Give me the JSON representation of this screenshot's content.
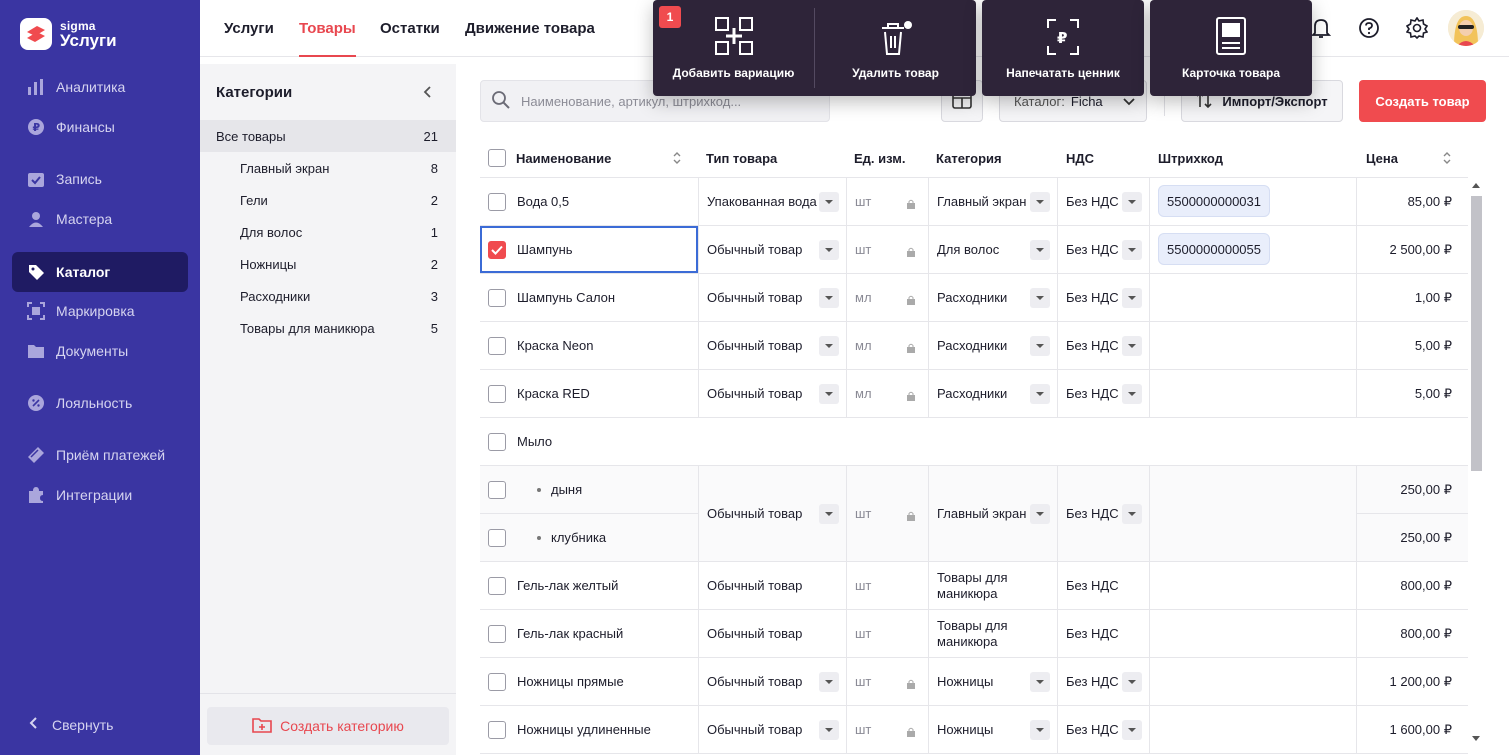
{
  "brand": {
    "sub": "sigma",
    "main": "Услуги"
  },
  "sidebar": {
    "items": [
      {
        "label": "Аналитика",
        "icon": "chart-icon"
      },
      {
        "label": "Финансы",
        "icon": "ruble-icon"
      },
      {
        "label": "Запись",
        "icon": "calendar-icon"
      },
      {
        "label": "Мастера",
        "icon": "user-icon"
      },
      {
        "label": "Каталог",
        "icon": "tag-icon",
        "active": true
      },
      {
        "label": "Маркировка",
        "icon": "qr-icon"
      },
      {
        "label": "Документы",
        "icon": "folder-icon"
      },
      {
        "label": "Лояльность",
        "icon": "discount-icon"
      },
      {
        "label": "Приём платежей",
        "icon": "card-icon"
      },
      {
        "label": "Интеграции",
        "icon": "puzzle-icon"
      }
    ],
    "collapse_label": "Свернуть"
  },
  "tabs": [
    {
      "label": "Услуги"
    },
    {
      "label": "Товары",
      "active": true
    },
    {
      "label": "Остатки"
    },
    {
      "label": "Движение товара"
    }
  ],
  "categories": {
    "title": "Категории",
    "items": [
      {
        "name": "Все товары",
        "count": "21",
        "selected": true
      },
      {
        "name": "Главный экран",
        "count": "8"
      },
      {
        "name": "Гели",
        "count": "2"
      },
      {
        "name": "Для волос",
        "count": "1"
      },
      {
        "name": "Ножницы",
        "count": "2"
      },
      {
        "name": "Расходники",
        "count": "3"
      },
      {
        "name": "Товары для маникюра",
        "count": "5"
      }
    ],
    "create_label": "Создать категорию"
  },
  "toolbar": {
    "search_placeholder": "Наименование, артикул, штрихкод...",
    "catalog_label": "Каталог:",
    "catalog_value": "Ficha",
    "import_label": "Импорт/Экспорт",
    "create_label": "Создать товар"
  },
  "table": {
    "headers": {
      "name": "Наименование",
      "type": "Тип товара",
      "unit": "Ед. изм.",
      "category": "Категория",
      "vat": "НДС",
      "barcode": "Штрихкод",
      "price": "Цена"
    },
    "rows": [
      {
        "name": "Вода 0,5",
        "type": "Упакованная вода",
        "unit": "шт",
        "category": "Главный экран",
        "vat": "Без НДС",
        "barcode": "5500000000031",
        "price": "85,00 ₽",
        "checked": false
      },
      {
        "name": "Шампунь",
        "type": "Обычный товар",
        "unit": "шт",
        "category": "Для волос",
        "vat": "Без НДС",
        "barcode": "5500000000055",
        "price": "2 500,00 ₽",
        "checked": true
      },
      {
        "name": "Шампунь Салон",
        "type": "Обычный товар",
        "unit": "мл",
        "category": "Расходники",
        "vat": "Без НДС",
        "barcode": "",
        "price": "1,00 ₽",
        "checked": false
      },
      {
        "name": "Краска Neon",
        "type": "Обычный товар",
        "unit": "мл",
        "category": "Расходники",
        "vat": "Без НДС",
        "barcode": "",
        "price": "5,00 ₽",
        "checked": false
      },
      {
        "name": "Краска RED",
        "type": "Обычный товар",
        "unit": "мл",
        "category": "Расходники",
        "vat": "Без НДС",
        "barcode": "",
        "price": "5,00 ₽",
        "checked": false
      }
    ],
    "group": {
      "name": "Мыло",
      "type": "Обычный товар",
      "unit": "шт",
      "category": "Главный экран",
      "vat": "Без НДС",
      "variants": [
        {
          "name": "дыня",
          "price": "250,00 ₽"
        },
        {
          "name": "клубника",
          "price": "250,00 ₽"
        }
      ]
    },
    "rows2": [
      {
        "name": "Гель-лак желтый",
        "type": "Обычный товар",
        "unit": "шт",
        "category": "Товары для маникюра",
        "vat": "Без НДС",
        "price": "800,00 ₽"
      },
      {
        "name": "Гель-лак красный",
        "type": "Обычный товар",
        "unit": "шт",
        "category": "Товары для маникюра",
        "vat": "Без НДС",
        "price": "800,00 ₽"
      },
      {
        "name": "Ножницы прямые",
        "type": "Обычный товар",
        "unit": "шт",
        "category": "Ножницы",
        "vat": "Без НДС",
        "price": "1 200,00 ₽"
      },
      {
        "name": "Ножницы удлиненные",
        "type": "Обычный товар",
        "unit": "шт",
        "category": "Ножницы",
        "vat": "Без НДС",
        "price": "1 600,00 ₽"
      }
    ]
  },
  "actions": {
    "selected_count": "1",
    "add_variation": "Добавить вариацию",
    "delete": "Удалить товар",
    "print_tag": "Напечатать ценник",
    "card": "Карточка товара"
  },
  "colors": {
    "sidebar": "#3a35a2",
    "accent": "#f04b4f",
    "action_bar": "#2e2439"
  }
}
